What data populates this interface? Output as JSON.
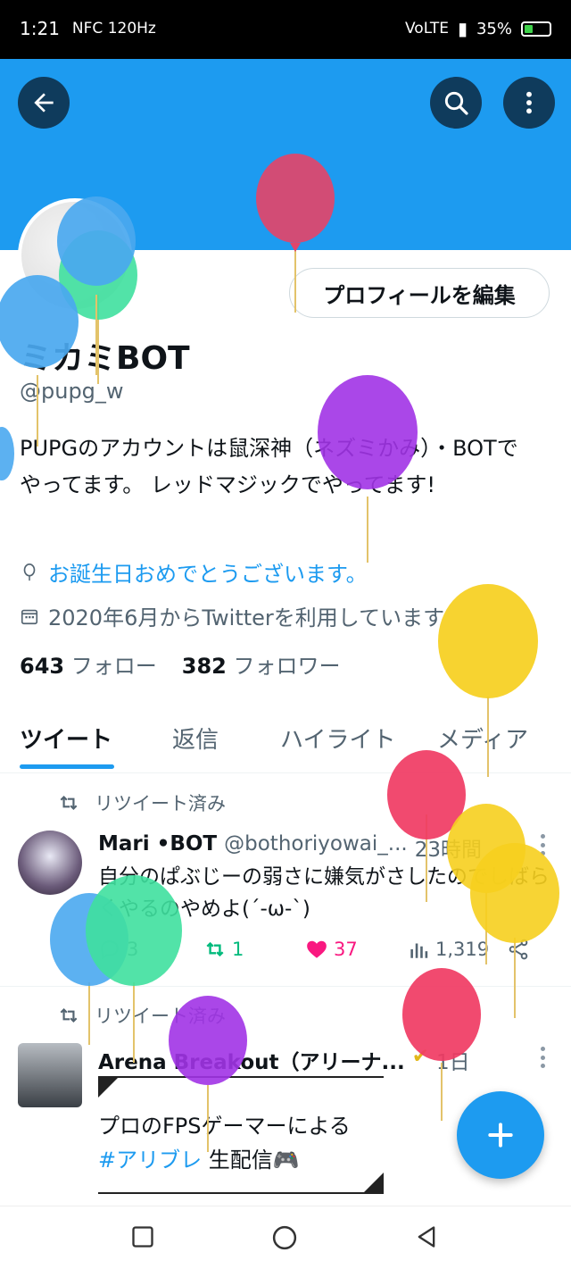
{
  "status_bar": {
    "time": "1:21",
    "left_icons": "NFC 120Hz",
    "network": "VoLTE",
    "battery": "35%",
    "battery_level": 0.35,
    "battery_color": "#3ed14a"
  },
  "header": {
    "banner_color": "#1d9bf0",
    "back_icon": "back-arrow-icon",
    "search_icon": "search-icon",
    "more_icon": "more-vertical-icon"
  },
  "profile": {
    "edit_button_label": "プロフィールを編集",
    "name": "ミカミBOT",
    "handle": "@pupg_w",
    "bio": "PUPGのアカウントは鼠深神（ネズミかみ）・BOTでやってます。 レッドマジックでやってます!",
    "birthday": "お誕生日おめでとうございます。",
    "joined": "2020年6月からTwitterを利用しています",
    "following_count": "643",
    "following_label": "フォロー",
    "followers_count": "382",
    "followers_label": "フォロワー"
  },
  "tabs": [
    {
      "label": "ツイート",
      "active": true
    },
    {
      "label": "返信",
      "active": false
    },
    {
      "label": "ハイライト",
      "active": false
    },
    {
      "label": "メディア",
      "active": false
    }
  ],
  "tweets": [
    {
      "retweet_label": "リツイート済み",
      "author_name": "Mari •BOT",
      "author_handle": "@bothoriyowai_...",
      "time": "23時間",
      "text": "自分のぱぶじーの弱さに嫌気がさしたのでしばらくやるのやめよ(´-ω-`)",
      "replies": "3",
      "retweets": "1",
      "likes": "37",
      "views": "1,319"
    },
    {
      "retweet_label": "リツイート済み",
      "author_name": "Arena Breakout（アリーナ...",
      "time": "1日",
      "card_line1": "プロのFPSゲーマーによる",
      "card_hashtag": "#アリブレ",
      "card_line2_rest": " 生配信🎮"
    }
  ],
  "colors": {
    "accent": "#1d9bf0",
    "like": "#f91880",
    "retweet_active": "#00ba7c"
  }
}
